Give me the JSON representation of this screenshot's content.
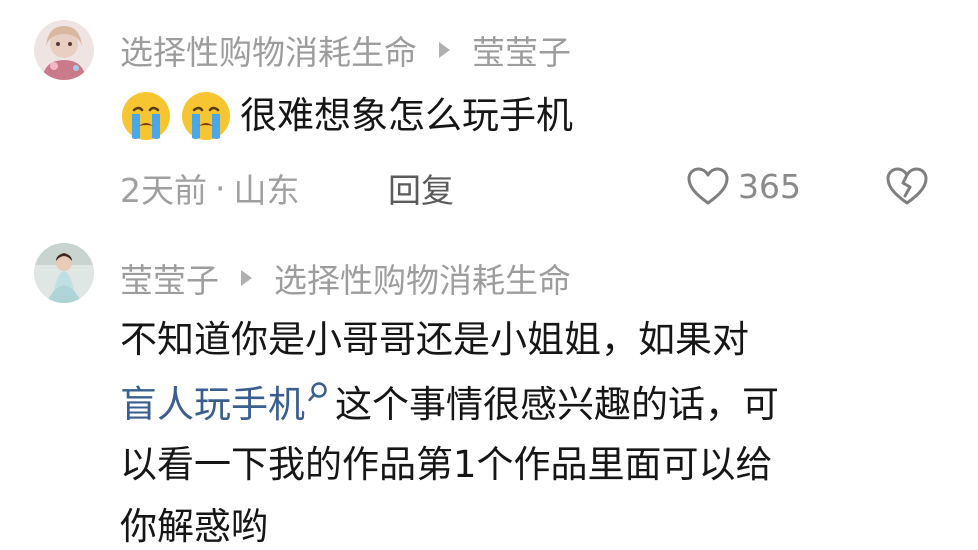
{
  "comments": [
    {
      "author": "选择性购物消耗生命",
      "reply_to": "莹莹子",
      "text": "很难想象怎么玩手机",
      "emojis": [
        "crying-face",
        "crying-face"
      ],
      "time": "2天前",
      "separator": "·",
      "location": "山东",
      "reply_label": "回复",
      "like_count": "365"
    },
    {
      "author": "莹莹子",
      "reply_to": "选择性购物消耗生命",
      "lines": {
        "line1": "不知道你是小哥哥还是小姐姐，如果对",
        "line2_link": "盲人玩手机",
        "line2_rest": "这个事情很感兴趣的话，可",
        "line3": "以看一下我的作品第1个作品里面可以给",
        "line4": "你解惑哟"
      }
    }
  ],
  "colors": {
    "link": "#3a5f8f",
    "meta": "#9d9d9d",
    "text": "#161616"
  }
}
